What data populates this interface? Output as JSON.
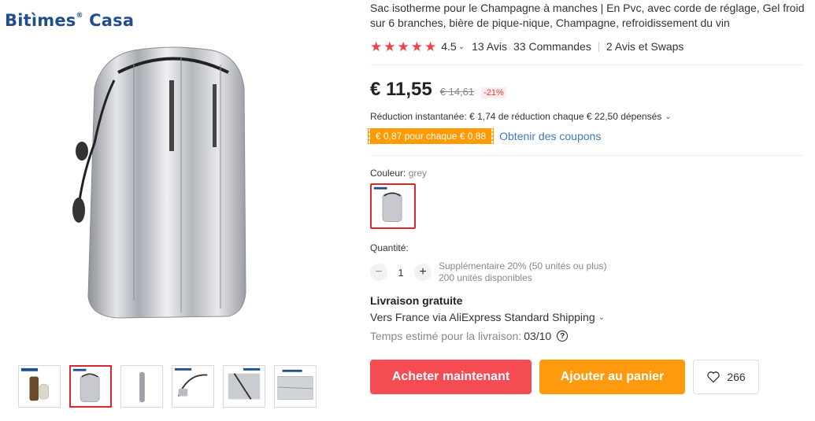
{
  "brand": {
    "logo_text": "Bitìmes",
    "logo_mark": "®",
    "logo_text2": " Casa"
  },
  "product": {
    "title": "Sac isotherme pour le Champagne à manches | En Pvc, avec corde de réglage, Gel froid sur 6 branches, bière de pique-nique, Champagne, refroidissement du vin",
    "rating_stars": 5,
    "rating_value": "4.5",
    "reviews": "13 Avis",
    "orders": "33 Commandes",
    "swaps": "2 Avis et Swaps"
  },
  "price": {
    "current": "€ 11,55",
    "original": "€ 14,61",
    "discount": "-21%"
  },
  "promo": {
    "instant": "Réduction instantanée: € 1,74 de réduction chaque € 22,50 dépensés",
    "coupon_badge": "€ 0,87 pour chaque € 0,88",
    "coupon_link": "Obtenir des coupons"
  },
  "color": {
    "label": "Couleur:",
    "value": "grey"
  },
  "quantity": {
    "label": "Quantité:",
    "minus": "−",
    "plus": "+",
    "value": "1",
    "extra": "Supplémentaire 20% (50 unités ou plus)",
    "available": "200 unités disponibles"
  },
  "shipping": {
    "title": "Livraison gratuite",
    "method": "Vers France via AliExpress Standard Shipping",
    "time_label": "Temps estimé pour la livraison:",
    "time_value": "03/10",
    "help": "?"
  },
  "actions": {
    "buy": "Acheter maintenant",
    "cart": "Ajouter au panier",
    "wishlist_count": "266"
  },
  "colors": {
    "accent": "#f54c54",
    "orange": "#ff9a0e",
    "link": "#3a7ac7",
    "star": "#f0424b"
  },
  "icons": {
    "chevron": "chevron-down-icon",
    "heart": "heart-icon",
    "help": "help-icon"
  }
}
